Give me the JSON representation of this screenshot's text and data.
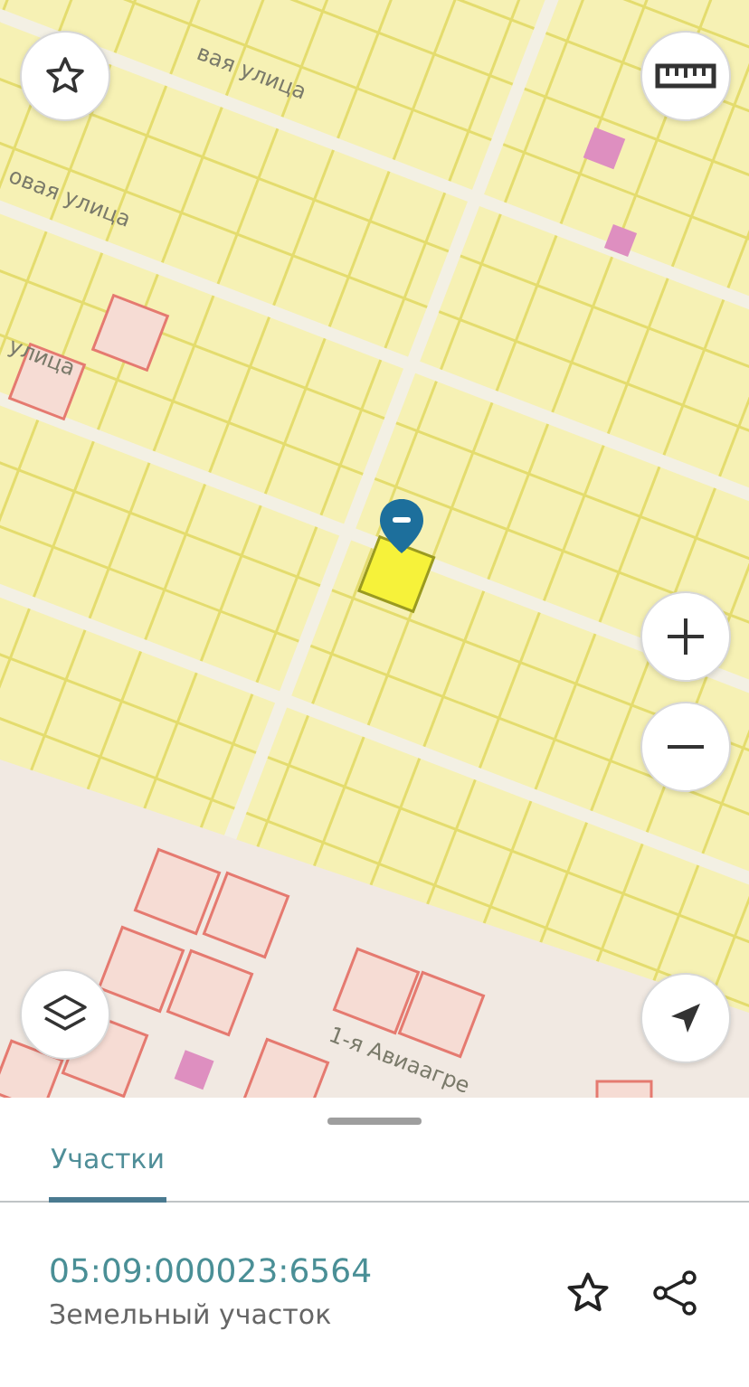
{
  "map": {
    "street_labels": [
      {
        "text": "вая улица",
        "kind": "top"
      },
      {
        "text": "овая улица",
        "kind": "upper"
      },
      {
        "text": "улица",
        "kind": "middle"
      },
      {
        "text": "1-я Авиаагре",
        "kind": "bottom"
      }
    ]
  },
  "tabs": [
    {
      "label": "Участки",
      "selected": true
    }
  ],
  "parcel": {
    "number": "05:09:000023:6564",
    "type": "Земельный участок"
  }
}
